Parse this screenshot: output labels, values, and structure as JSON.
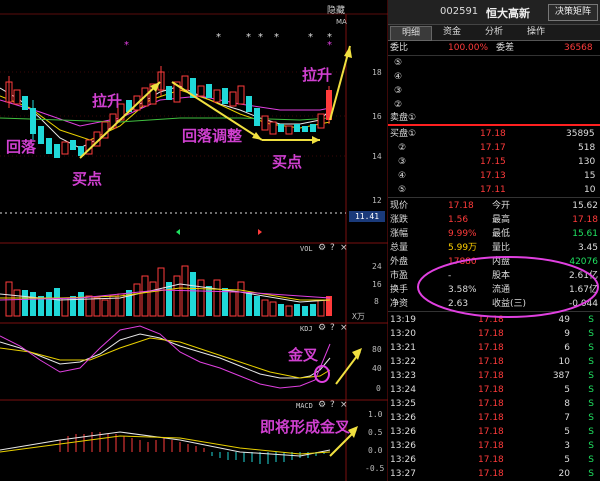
{
  "chart": {
    "hide_label": "隐藏",
    "ma_label": "MA",
    "price_ticks": [
      "18",
      "16",
      "14",
      "12"
    ],
    "crosshair_value": "11.41",
    "annotations": {
      "huiluo": "回落",
      "laSheng1": "拉升",
      "maidian1": "买点",
      "huiluo_tiaozheng": "回落调整",
      "maidian2": "买点",
      "laSheng2": "拉升",
      "jincha": "金叉",
      "jijiang": "即将形成金叉"
    },
    "vol": {
      "label": "VOL",
      "ticks": [
        "24",
        "16",
        "8"
      ],
      "unit": "X万"
    },
    "kdj": {
      "label": "KDJ",
      "ticks": [
        "80",
        "40",
        "0"
      ]
    },
    "macd": {
      "label": "MACD",
      "ticks": [
        "1.0",
        "0.5",
        "0.0",
        "-0.5"
      ]
    },
    "controls": [
      "⚙",
      "?",
      "×"
    ]
  },
  "quote": {
    "code": "002591",
    "name": "恒大高新",
    "button": "决策矩阵",
    "tabs": [
      "明细",
      "资金",
      "分析",
      "操作"
    ],
    "weibi": {
      "label": "委比",
      "value": "100.00%",
      "label2": "委差",
      "value2": "36568"
    },
    "sell_labels": [
      "⑤",
      "④",
      "③",
      "②",
      "卖盘①"
    ],
    "buy": [
      {
        "label": "买盘①",
        "price": "17.18",
        "vol": "35895"
      },
      {
        "label": "②",
        "price": "17.17",
        "vol": "518"
      },
      {
        "label": "③",
        "price": "17.15",
        "vol": "130"
      },
      {
        "label": "④",
        "price": "17.13",
        "vol": "15"
      },
      {
        "label": "⑤",
        "price": "17.11",
        "vol": "10"
      }
    ],
    "stats": [
      {
        "l1": "现价",
        "v1": "17.18",
        "l2": "今开",
        "v2": "15.62",
        "c1": "red",
        "c2": "white"
      },
      {
        "l1": "涨跌",
        "v1": "1.56",
        "l2": "最高",
        "v2": "17.18",
        "c1": "red",
        "c2": "red"
      },
      {
        "l1": "涨幅",
        "v1": "9.99%",
        "l2": "最低",
        "v2": "15.61",
        "c1": "red",
        "c2": "green"
      },
      {
        "l1": "总量",
        "v1": "5.99万",
        "l2": "量比",
        "v2": "3.45",
        "c1": "yellow",
        "c2": "white"
      },
      {
        "l1": "外盘",
        "v1": "17880",
        "l2": "内盘",
        "v2": "42076",
        "c1": "red",
        "c2": "green"
      },
      {
        "l1": "市盈",
        "v1": "-",
        "l2": "股本",
        "v2": "2.61亿",
        "c1": "white",
        "c2": "white"
      },
      {
        "l1": "换手",
        "v1": "3.58%",
        "l2": "流通",
        "v2": "1.67亿",
        "c1": "white",
        "c2": "white"
      },
      {
        "l1": "净资",
        "v1": "2.63",
        "l2": "收益(三)",
        "v2": "-0.044",
        "c1": "white",
        "c2": "white"
      }
    ],
    "ticks": [
      {
        "t": "13:19",
        "p": "17.18",
        "v": "49",
        "d": "S"
      },
      {
        "t": "13:20",
        "p": "17.18",
        "v": "9",
        "d": "S"
      },
      {
        "t": "13:21",
        "p": "17.18",
        "v": "6",
        "d": "S"
      },
      {
        "t": "13:22",
        "p": "17.18",
        "v": "10",
        "d": "S"
      },
      {
        "t": "13:23",
        "p": "17.18",
        "v": "387",
        "d": "S"
      },
      {
        "t": "13:24",
        "p": "17.18",
        "v": "5",
        "d": "S"
      },
      {
        "t": "13:25",
        "p": "17.18",
        "v": "8",
        "d": "S"
      },
      {
        "t": "13:26",
        "p": "17.18",
        "v": "7",
        "d": "S"
      },
      {
        "t": "13:26",
        "p": "17.18",
        "v": "5",
        "d": "S"
      },
      {
        "t": "13:26",
        "p": "17.18",
        "v": "3",
        "d": "S"
      },
      {
        "t": "13:26",
        "p": "17.18",
        "v": "5",
        "d": "S"
      },
      {
        "t": "13:27",
        "p": "17.18",
        "v": "20",
        "d": "S"
      }
    ]
  }
}
